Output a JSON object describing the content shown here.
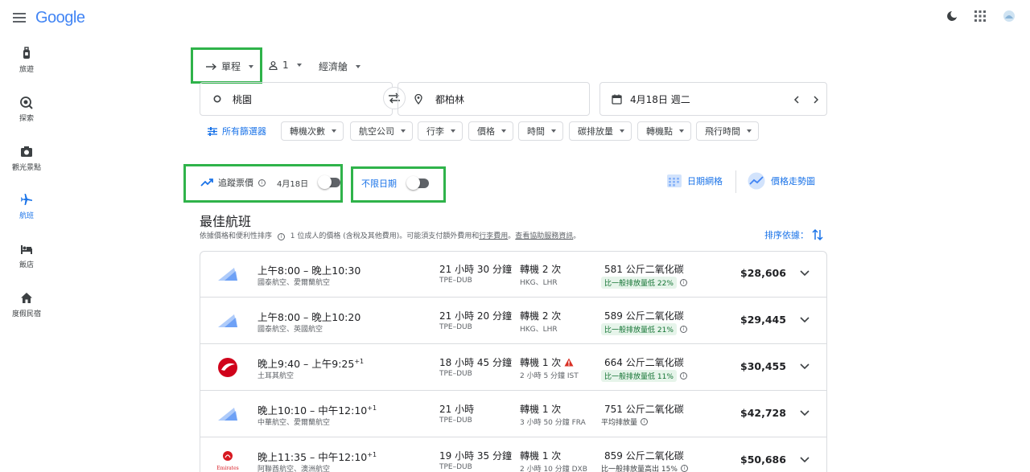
{
  "header": {
    "logo_text": "Google"
  },
  "sidebar": {
    "items": [
      {
        "label": "旅遊",
        "icon": "luggage-icon"
      },
      {
        "label": "探索",
        "icon": "explore-icon"
      },
      {
        "label": "觀光景點",
        "icon": "camera-icon"
      },
      {
        "label": "航班",
        "icon": "flight-icon",
        "active": true
      },
      {
        "label": "飯店",
        "icon": "hotel-icon"
      },
      {
        "label": "度假民宿",
        "icon": "house-icon"
      }
    ]
  },
  "controls": {
    "trip_type": "單程",
    "passengers": "1",
    "cabin_class": "經濟艙"
  },
  "search": {
    "origin": "桃園",
    "destination": "都柏林",
    "date": "4月18日 週二"
  },
  "filters": {
    "all_filters_label": "所有篩選器",
    "chips": [
      "轉機次數",
      "航空公司",
      "行李",
      "價格",
      "時間",
      "碳排放量",
      "轉機點",
      "飛行時間"
    ]
  },
  "tracking": {
    "track_prices_label": "追蹤票價",
    "track_date": "4月18日",
    "any_dates_label": "不限日期",
    "date_grid_label": "日期網格",
    "price_graph_label": "價格走勢圖"
  },
  "results_header": {
    "title": "最佳航班",
    "subtitle_a": "依據價格和便利性排序",
    "subtitle_b": "1 位成人的價格 (含稅及其他費用)。可能須支付額外費用和",
    "subtitle_link1": "行李費用",
    "subtitle_c": "。",
    "subtitle_link2": "查看協助服務資訊",
    "subtitle_d": "。",
    "sort_label": "排序依據："
  },
  "flights": [
    {
      "time": "上午8:00 – 晚上10:30",
      "sup": "",
      "airline": "國泰航空、愛爾蘭航空",
      "duration": "21 小時 30 分鐘",
      "route": "TPE–DUB",
      "stops": "轉機 2 次",
      "warn": false,
      "via": "HKG、LHR",
      "co2": "581 公斤二氧化碳",
      "co2_note": "比一般排放量低 22%",
      "price": "$28,606",
      "logo": "generic"
    },
    {
      "time": "上午8:00 – 晚上10:20",
      "sup": "",
      "airline": "國泰航空、英國航空",
      "duration": "21 小時 20 分鐘",
      "route": "TPE–DUB",
      "stops": "轉機 2 次",
      "warn": false,
      "via": "HKG、LHR",
      "co2": "589 公斤二氧化碳",
      "co2_note": "比一般排放量低 21%",
      "price": "$29,445",
      "logo": "generic"
    },
    {
      "time": "晚上9:40 – 上午9:25",
      "sup": "+1",
      "airline": "土耳其航空",
      "duration": "18 小時 45 分鐘",
      "route": "TPE–DUB",
      "stops": "轉機 1 次",
      "warn": true,
      "via": "2 小時 5 分鐘 IST",
      "co2": "664 公斤二氧化碳",
      "co2_note": "比一般排放量低 11%",
      "price": "$30,455",
      "logo": "turkish"
    },
    {
      "time": "晚上10:10 – 中午12:10",
      "sup": "+1",
      "airline": "中華航空、愛爾蘭航空",
      "duration": "21 小時",
      "route": "TPE–DUB",
      "stops": "轉機 1 次",
      "warn": false,
      "via": "3 小時 50 分鐘 FRA",
      "co2": "751 公斤二氧化碳",
      "co2_note": "平均排放量",
      "price": "$42,728",
      "logo": "generic"
    },
    {
      "time": "晚上11:35 – 中午12:10",
      "sup": "+1",
      "airline": "阿聯酋航空、澳洲航空",
      "duration": "19 小時 35 分鐘",
      "route": "TPE–DUB",
      "stops": "轉機 1 次",
      "warn": false,
      "via": "2 小時 10 分鐘 DXB",
      "co2": "859 公斤二氧化碳",
      "co2_note": "比一般排放量高出 15%",
      "price": "$50,686",
      "logo": "emirates",
      "logo_text": "Emirates"
    }
  ]
}
